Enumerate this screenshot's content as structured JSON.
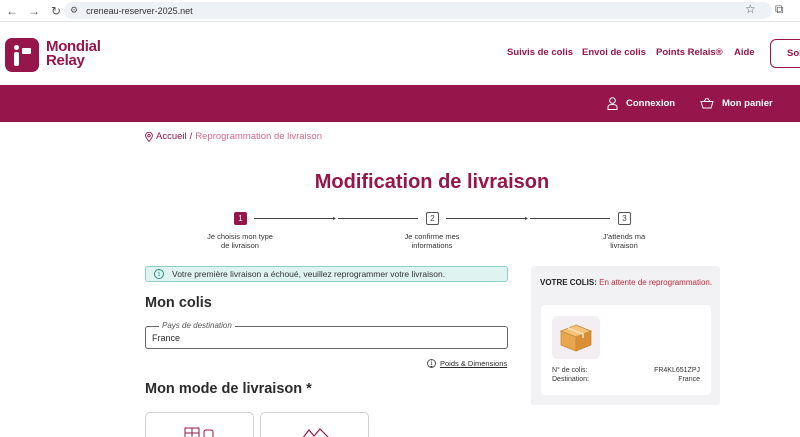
{
  "browser": {
    "back_icon": "arrow-left-icon",
    "forward_icon": "arrow-right-icon",
    "reload_icon": "reload-icon",
    "url": "creneau-reserver-2025.net"
  },
  "header": {
    "logo_line1": "Mondial",
    "logo_line2": "Relay",
    "nav": [
      "Suivis de colis",
      "Envoi de colis",
      "Points Relais®",
      "Aide"
    ],
    "cta_label": "Sol"
  },
  "topbar": {
    "login_label": "Connexion",
    "cart_label": "Mon panier"
  },
  "breadcrumb": {
    "home": "Accueil",
    "separator": "/",
    "current": "Reprogrammation de livraison"
  },
  "page": {
    "title": "Modification de livraison"
  },
  "stepper": {
    "steps": [
      {
        "number": "1",
        "label_line1": "Je choisis mon type",
        "label_line2": "de livraison",
        "active": true
      },
      {
        "number": "2",
        "label_line1": "Je confirme mes",
        "label_line2": "informations",
        "active": false
      },
      {
        "number": "3",
        "label_line1": "J'attends ma",
        "label_line2": "livraison",
        "active": false
      }
    ]
  },
  "alert": {
    "text": "Votre première livraison a échoué, veuillez reprogrammer votre livraison."
  },
  "colis": {
    "heading": "Mon colis",
    "country_legend": "Pays de destination",
    "country_value": "France",
    "dimensions_link": "Poids & Dimensions"
  },
  "mode": {
    "heading": "Mon mode de livraison *"
  },
  "panel": {
    "status_label": "VOTRE COLIS:",
    "status_text": "En attente de reprogrammation.",
    "parcel_no_label": "N° de colis:",
    "parcel_no_value": "FR4KL651ZPJ",
    "destination_label": "Destination:",
    "destination_value": "France"
  },
  "colors": {
    "brand": "#96154a",
    "alert_bg": "#dff3f1",
    "status_red": "#c0283a"
  }
}
